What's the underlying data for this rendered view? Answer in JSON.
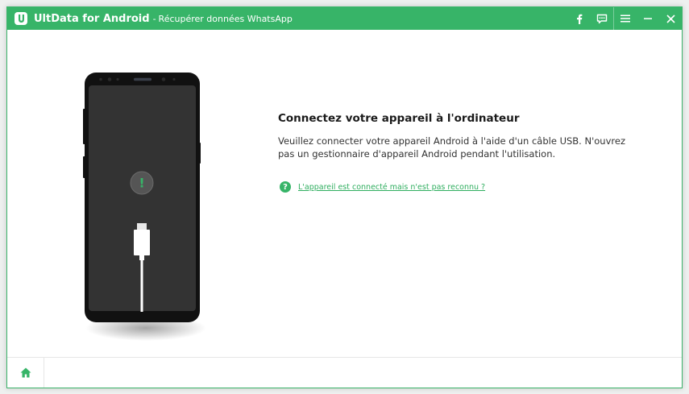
{
  "window": {
    "app_name": "UltData for Android",
    "separator": "-",
    "subtitle": "Récupérer données WhatsApp"
  },
  "titlebar_icons": [
    "facebook-icon",
    "feedback-icon",
    "menu-icon",
    "minimize-icon",
    "close-icon"
  ],
  "main": {
    "heading": "Connectez votre appareil à l'ordinateur",
    "description": "Veuillez connecter votre appareil Android à l'aide d'un câble USB. N'ouvrez pas un gestionnaire d'appareil Android pendant l'utilisation.",
    "help_icon": "?",
    "help_link": "L'appareil est connecté mais n'est pas reconnu ?",
    "phone_alert": "!"
  },
  "footer": {
    "home_icon": "home-icon"
  },
  "colors": {
    "accent": "#37b468",
    "link": "#2fae5f",
    "phone_body": "#111111",
    "phone_screen": "#333333",
    "alert_circle": "#555555"
  }
}
